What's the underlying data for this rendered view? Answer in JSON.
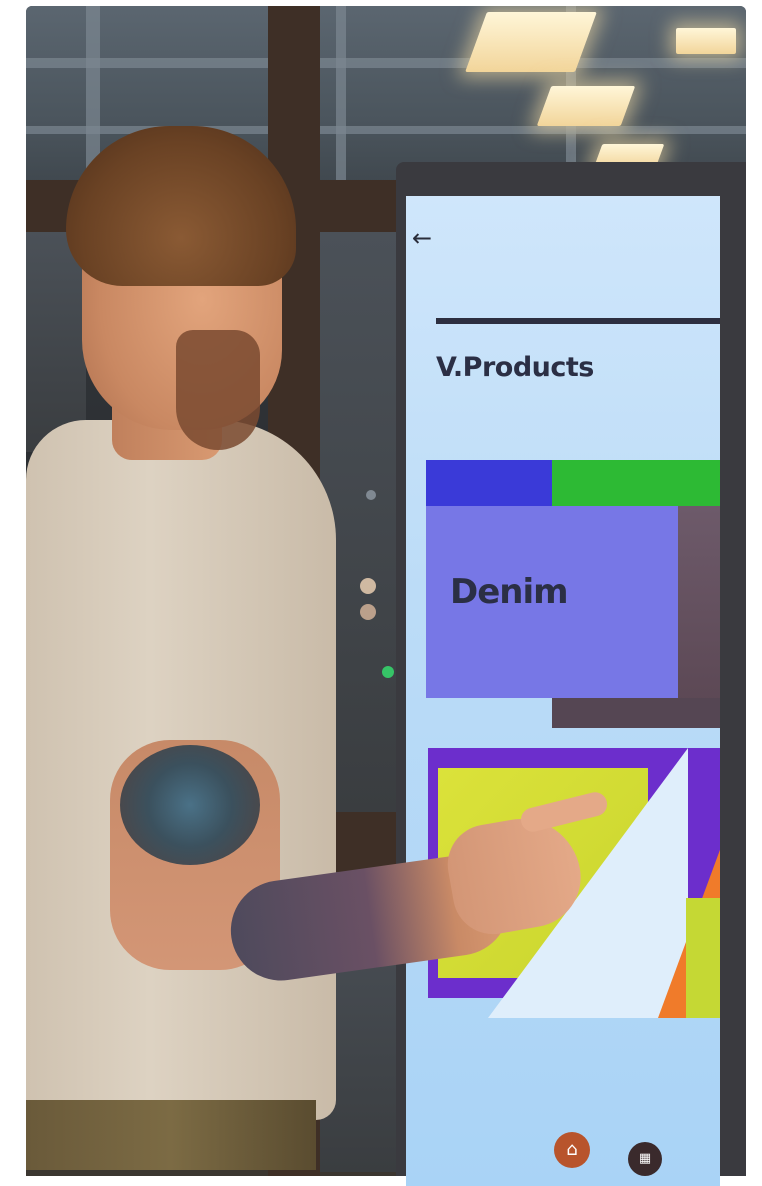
{
  "kiosk": {
    "back_icon": "arrow-left-icon",
    "title": "V.Products",
    "tiles": [
      {
        "label": "Denim"
      }
    ],
    "nav_icons": [
      "home-icon",
      "qr-scan-icon"
    ]
  },
  "colors": {
    "screen_background": "#bcdcf7",
    "title_text": "#2b2f45",
    "denim_tile": "#7777e6",
    "accent_blue": "#3a3ad8",
    "accent_green": "#2dba34",
    "accent_purple": "#6c2ecc",
    "accent_yellow": "#dbe23a",
    "accent_orange": "#f07b2a"
  }
}
